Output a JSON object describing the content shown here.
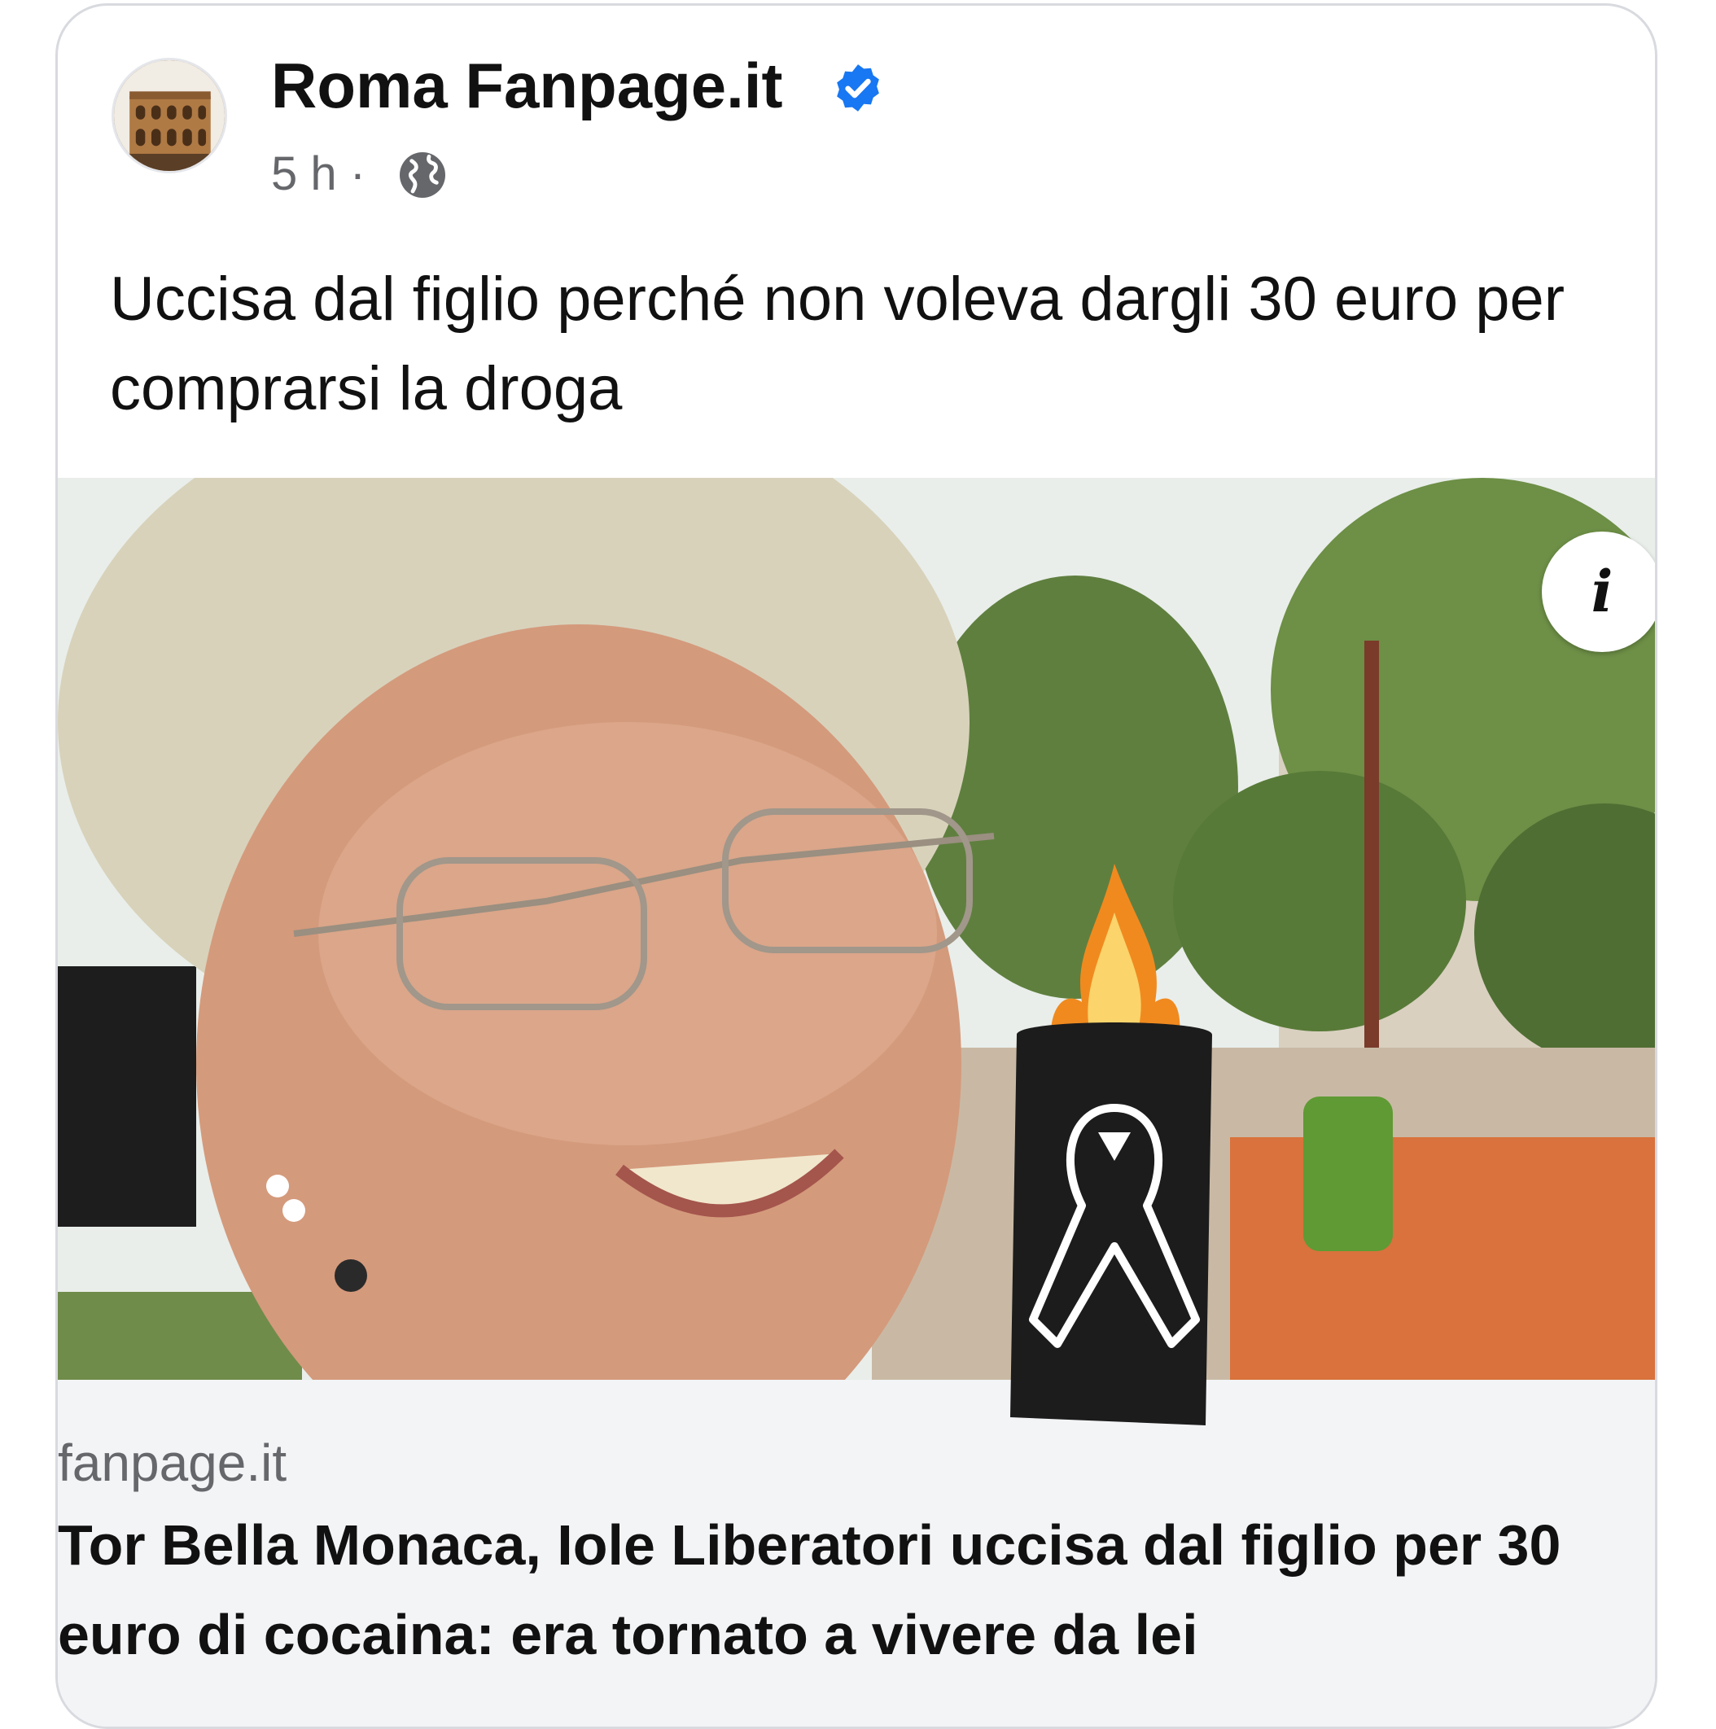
{
  "post": {
    "page_name": "Roma Fanpage.it",
    "time": "5 h ·",
    "caption": "Uccisa dal figlio perché non voleva dargli 30 euro per comprarsi la droga",
    "info_icon": "i"
  },
  "link_preview": {
    "domain": "fanpage.it",
    "title": "Tor Bella Monaca, Iole Liberatori uccisa dal figlio per 30 euro di cocaina: era tornato a vivere da lei"
  },
  "icons": {
    "verified": "verified-badge-icon",
    "audience": "globe-icon",
    "info": "info-icon"
  },
  "colors": {
    "verified_blue": "#1877f2",
    "secondary_text": "#65676b",
    "link_bg": "#f3f4f6"
  }
}
